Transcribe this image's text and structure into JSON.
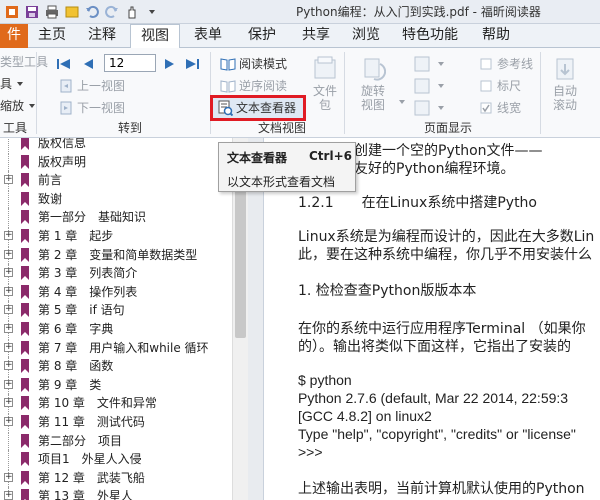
{
  "window": {
    "title": "Python编程：从入门到实践.pdf - 福昕阅读器"
  },
  "tabs": [
    {
      "label": "件",
      "key": "file"
    },
    {
      "label": "主页",
      "key": "home"
    },
    {
      "label": "注释",
      "key": "comment"
    },
    {
      "label": "视图",
      "key": "view"
    },
    {
      "label": "表单",
      "key": "form"
    },
    {
      "label": "保护",
      "key": "protect"
    },
    {
      "label": "共享",
      "key": "share"
    },
    {
      "label": "浏览",
      "key": "browse"
    },
    {
      "label": "特色功能",
      "key": "features"
    },
    {
      "label": "帮助",
      "key": "help"
    }
  ],
  "ribbon": {
    "tools_group": {
      "label": "工具",
      "items": [
        "类型工具",
        "具",
        "缩放"
      ]
    },
    "goto_group": {
      "label": "转到",
      "page_value": "12",
      "prev_view": "上一视图",
      "next_view": "下一视图"
    },
    "docview_group": {
      "label": "文档视图",
      "reading_mode": "阅读模式",
      "reverse_reading": "逆序阅读",
      "text_viewer": "文本查看器",
      "file_pkg": "文件包",
      "file_top": "文件",
      "file_bottom": "包"
    },
    "pagedisplay_group": {
      "label": "页面显示",
      "rotate_top": "旋转",
      "rotate_bottom": "视图",
      "ref_line": "参考线",
      "ruler": "标尺",
      "line_width": "线宽",
      "auto_top": "自动",
      "auto_bottom": "滚动"
    }
  },
  "tooltip": {
    "title": "文本查看器",
    "shortcut": "Ctrl+6",
    "description": "以文本形式查看文档"
  },
  "bookmarks": [
    {
      "label": "版权信息",
      "expandable": false
    },
    {
      "label": "版权声明",
      "expandable": false
    },
    {
      "label": "前言",
      "expandable": true
    },
    {
      "label": "致谢",
      "expandable": false
    },
    {
      "label": "第一部分　基础知识",
      "expandable": false
    },
    {
      "label": "第 1 章　起步",
      "expandable": true
    },
    {
      "label": "第 2 章　变量和简单数据类型",
      "expandable": true
    },
    {
      "label": "第 3 章　列表简介",
      "expandable": true
    },
    {
      "label": "第 4 章　操作列表",
      "expandable": true
    },
    {
      "label": "第 5 章　if 语句",
      "expandable": true
    },
    {
      "label": "第 6 章　字典",
      "expandable": true
    },
    {
      "label": "第 7 章　用户输入和while 循环",
      "expandable": true
    },
    {
      "label": "第 8 章　函数",
      "expandable": true
    },
    {
      "label": "第 9 章　类",
      "expandable": true
    },
    {
      "label": "第 10 章　文件和异常",
      "expandable": true
    },
    {
      "label": "第 11 章　测试代码",
      "expandable": true
    },
    {
      "label": "第二部分　项目",
      "expandable": false
    },
    {
      "label": "项目1　外星人入侵",
      "expandable": false
    },
    {
      "label": "第 12 章　武装飞船",
      "expandable": true
    },
    {
      "label": "第 13 章　外星人",
      "expandable": true
    },
    {
      "label": "记分",
      "expandable": true
    }
  ],
  "document": {
    "lines": [
      "辑器，并创建一个空的Python文件——",
      "对初学者友好的Python编程环境。",
      "1.2.1　　在在Linux系统中搭建Pytho",
      "Linux系统是为编程而设计的，因此在大多数Lin",
      "此，要在这种系统中编程，你几乎不用安装什么",
      "1. 检检查查Python版版本本",
      "在你的系统中运行应用程序Terminal （如果你",
      "的）。输出将类似下面这样，它指出了安装的",
      "$ python",
      "Python 2.7.6  (default, Mar 22 2014, 22:59:3",
      "[GCC 4.8.2] on linux2",
      "Type \"help\", \"copyright\", \"credits\" or \"license\"",
      ">>>",
      "上述输出表明，当前计算机默认使用的Python"
    ]
  },
  "colors": {
    "accent": "#e06a1b",
    "highlight": "#e01b24",
    "flag": "#8b2a6a"
  }
}
